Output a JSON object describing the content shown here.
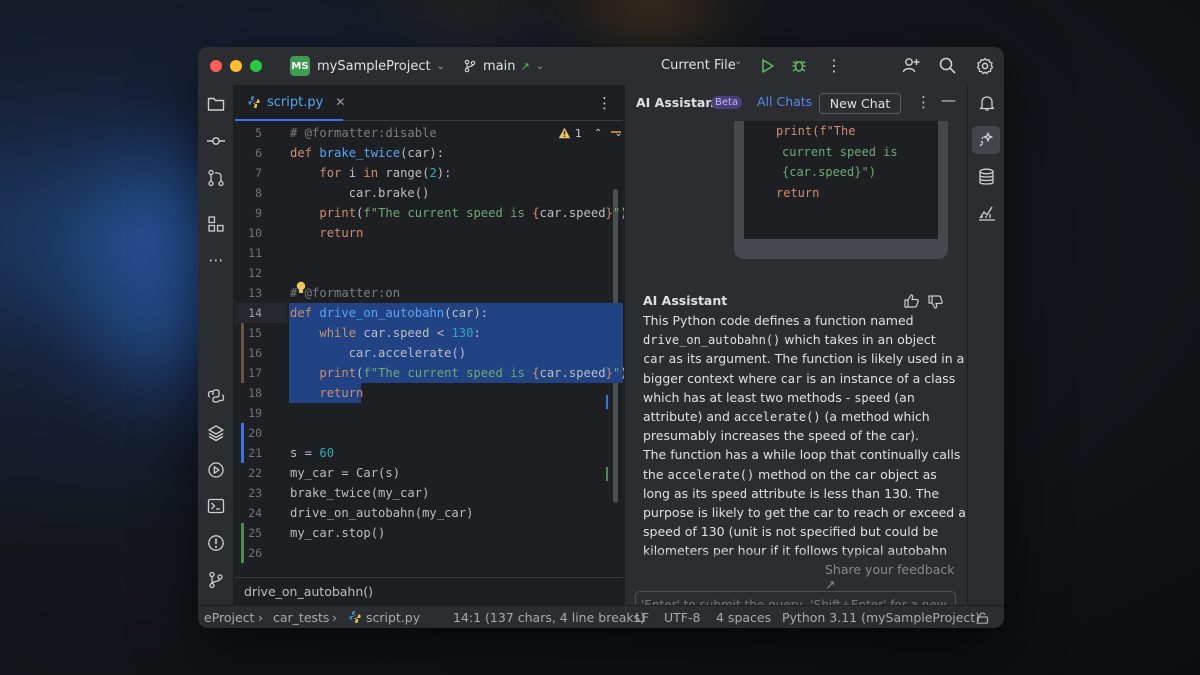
{
  "colors": {
    "accent": "#3574f0",
    "selection": "#214283",
    "keyword": "#cf8e6d",
    "function": "#56a8f5",
    "number": "#2aacb8",
    "string": "#6aab73",
    "warning": "#f2c55c"
  },
  "titlebar": {
    "project_badge": "MS",
    "project_name": "mySampleProject",
    "branch": "main",
    "run_config": "Current File"
  },
  "editor": {
    "tab_label": "script.py",
    "warning_count": "1",
    "breadcrumb": "drive_on_autobahn()",
    "lines": [
      {
        "n": "5",
        "t": "# @formatter:disable"
      },
      {
        "n": "6",
        "t": "def brake_twice(car):"
      },
      {
        "n": "7",
        "t": "for i in range(2):"
      },
      {
        "n": "8",
        "t": "car.brake()"
      },
      {
        "n": "9",
        "t": "print(f\"The current speed is {car.speed}\")"
      },
      {
        "n": "10",
        "t": "return"
      },
      {
        "n": "11",
        "t": ""
      },
      {
        "n": "12",
        "t": ""
      },
      {
        "n": "13",
        "t": "# @formatter:on"
      },
      {
        "n": "14",
        "t": "def drive_on_autobahn(car):"
      },
      {
        "n": "15",
        "t": "while car.speed < 130:"
      },
      {
        "n": "16",
        "t": "car.accelerate()"
      },
      {
        "n": "17",
        "t": "print(f\"The current speed is {car.speed}\")"
      },
      {
        "n": "18",
        "t": "return"
      },
      {
        "n": "19",
        "t": ""
      },
      {
        "n": "20",
        "t": ""
      },
      {
        "n": "21",
        "t": "s = 60"
      },
      {
        "n": "22",
        "t": "my_car = Car(s)"
      },
      {
        "n": "23",
        "t": "brake_twice(my_car)"
      },
      {
        "n": "24",
        "t": "drive_on_autobahn(my_car)"
      },
      {
        "n": "25",
        "t": "my_car.stop()"
      },
      {
        "n": "26",
        "t": ""
      }
    ]
  },
  "assistant": {
    "title": "AI Assistant",
    "beta_badge": "Beta",
    "all_chats": "All Chats",
    "new_chat": "New Chat",
    "user_snippet": [
      "print(f\"The",
      "current speed is",
      "{car.speed}\")",
      "return"
    ],
    "response_author": "AI Assistant",
    "response_lines": [
      "This Python code defines a function named",
      "drive_on_autobahn() which takes in an object",
      "car as its argument. The function is likely used in a",
      "bigger context where car is an instance of a class",
      "which has at least two methods - speed (an",
      "attribute) and accelerate() (a method which",
      "presumably increases the speed of the car).",
      "The function has a while loop that continually calls",
      "the accelerate() method on the car object as",
      "long as its speed attribute is less than 130. The",
      "purpose is likely to get the car to reach or exceed a",
      "speed of 130 (unit is not specified but could be",
      "kilometers per hour if it follows typical autobahn"
    ],
    "feedback_link": "Share your feedback ↗",
    "input_placeholder": "'Enter' to submit the query, 'Shift+Enter' for a new line"
  },
  "statusbar": {
    "crumbs": [
      "eProject",
      "car_tests",
      "script.py"
    ],
    "position": "14:1 (137 chars, 4 line breaks)",
    "line_sep": "LF",
    "encoding": "UTF-8",
    "indent": "4 spaces",
    "interpreter": "Python 3.11 (mySampleProject)"
  }
}
